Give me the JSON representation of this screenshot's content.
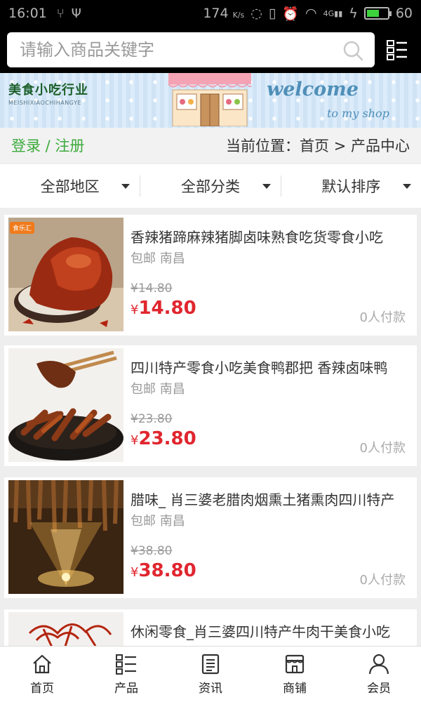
{
  "status_bar": {
    "time": "16:01",
    "speed": "174",
    "speed_unit": "K/s",
    "network": "4G",
    "battery": "60",
    "battery_level_percent": 60
  },
  "search": {
    "placeholder": "请输入商品关键字"
  },
  "banner": {
    "brand": "美食小吃行业",
    "brand_sub": "MEISHIXIAOCHIHANGYE",
    "welcome": "welcome",
    "tagline": "to my shop"
  },
  "location_bar": {
    "login_label": "登录 / 注册",
    "location": "当前位置：首页 > 产品中心"
  },
  "filters": [
    {
      "label": "全部地区"
    },
    {
      "label": "全部分类"
    },
    {
      "label": "默认排序"
    }
  ],
  "products": [
    {
      "title": "香辣猪蹄麻辣猪脚卤味熟食吃货零食小吃",
      "meta": "包邮 南昌",
      "old_price": "¥14.80",
      "price_symbol": "¥",
      "price": "14.80",
      "paid": "0人付款",
      "tag": "食乐汇"
    },
    {
      "title": "四川特产零食小吃美食鸭郡把 香辣卤味鸭",
      "meta": "包邮 南昌",
      "old_price": "¥23.80",
      "price_symbol": "¥",
      "price": "23.80",
      "paid": "0人付款"
    },
    {
      "title": "腊味_ 肖三婆老腊肉烟熏土猪熏肉四川特产",
      "meta": "包邮 南昌",
      "old_price": "¥38.80",
      "price_symbol": "¥",
      "price": "38.80",
      "paid": "0人付款"
    },
    {
      "title": "休闲零食_肖三婆四川特产牛肉干美食小吃",
      "meta": "",
      "old_price": "",
      "price_symbol": "",
      "price": "",
      "paid": ""
    }
  ],
  "bottom_nav": [
    {
      "label": "首页",
      "icon": "home-icon"
    },
    {
      "label": "产品",
      "icon": "list-icon"
    },
    {
      "label": "资讯",
      "icon": "news-icon"
    },
    {
      "label": "商铺",
      "icon": "store-icon"
    },
    {
      "label": "会员",
      "icon": "user-icon"
    }
  ]
}
